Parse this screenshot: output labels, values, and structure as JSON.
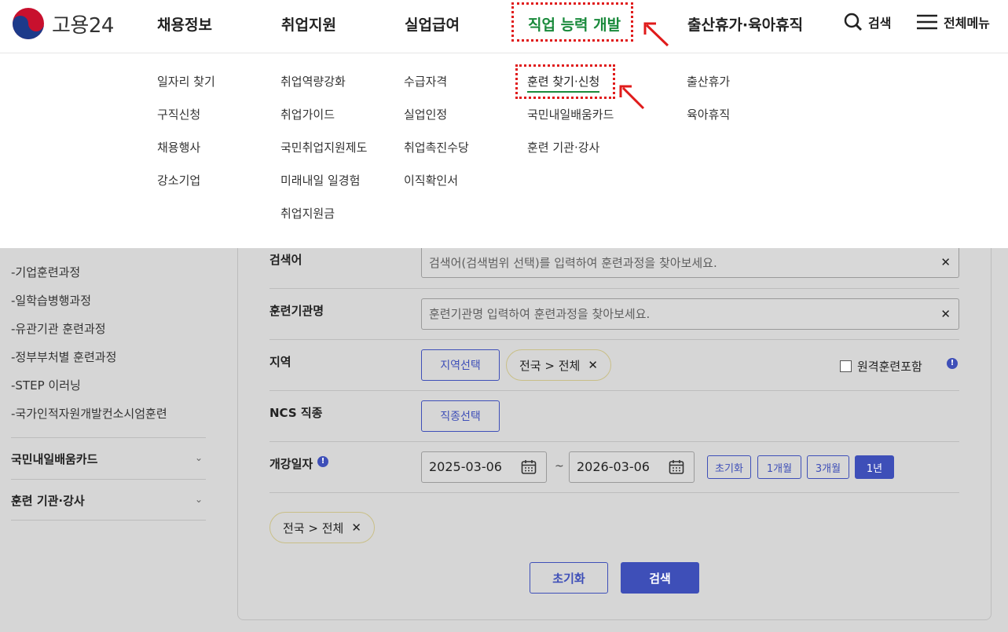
{
  "header": {
    "logo_text": "고용24",
    "nav": [
      "채용정보",
      "취업지원",
      "실업급여",
      "직업 능력 개발",
      "출산휴가·육아휴직"
    ],
    "search_label": "검색",
    "menu_label": "전체메뉴",
    "active_color": "#1a8a3c",
    "highlight_color": "#e01b1b"
  },
  "mega_menu": {
    "col1": [
      "일자리 찾기",
      "구직신청",
      "채용행사",
      "강소기업"
    ],
    "col2": [
      "취업역량강화",
      "취업가이드",
      "국민취업지원제도",
      "미래내일 일경험",
      "취업지원금"
    ],
    "col3": [
      "수급자격",
      "실업인정",
      "취업촉진수당",
      "이직확인서"
    ],
    "col4": [
      "훈련 찾기·신청",
      "국민내일배움카드",
      "훈련 기관·강사"
    ],
    "col5": [
      "출산휴가",
      "육아휴직"
    ]
  },
  "sidebar": {
    "items": [
      "-기업훈련과정",
      "-일학습병행과정",
      "-유관기관 훈련과정",
      "-정부부처별 훈련과정",
      "-STEP 이러닝",
      "-국가인적자원개발컨소시엄훈련"
    ],
    "sections": [
      "국민내일배움카드",
      "훈련 기관·강사"
    ]
  },
  "form": {
    "keyword_label": "검색어",
    "keyword_placeholder": "검색어(검색범위 선택)를 입력하여 훈련과정을 찾아보세요.",
    "institution_label": "훈련기관명",
    "institution_placeholder": "훈련기관명 입력하여 훈련과정을 찾아보세요.",
    "region_label": "지역",
    "region_button": "지역선택",
    "region_chip": "전국 > 전체",
    "remote_label": "원격훈련포함",
    "ncs_label": "NCS 직종",
    "ncs_button": "직종선택",
    "date_label": "개강일자",
    "date_start": "2025-03-06",
    "date_end": "2026-03-06",
    "date_sep": "~",
    "period_buttons": [
      "초기화",
      "1개월",
      "3개월",
      "1년"
    ],
    "selected_chip": "전국 > 전체",
    "reset_button": "초기화",
    "search_button": "검색",
    "accent_color": "#3e4fb8"
  }
}
